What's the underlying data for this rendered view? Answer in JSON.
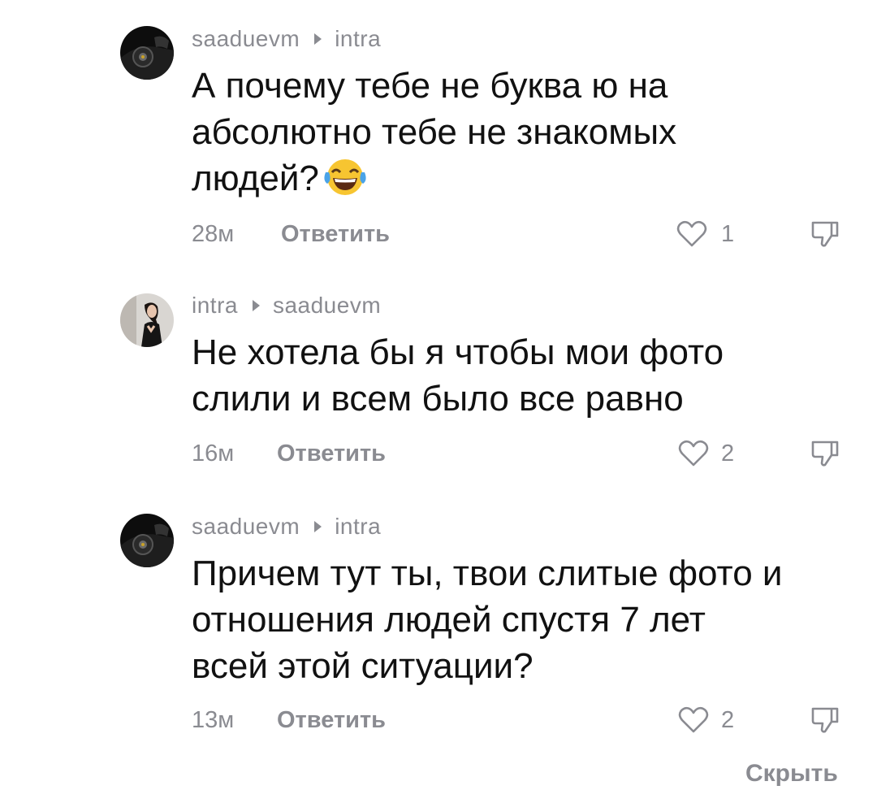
{
  "comments": [
    {
      "author": "saaduevm",
      "reply_to": "intra",
      "lines": [
        "А почему тебе не буква ю на",
        "абсолютно тебе не знакомых",
        "людей?"
      ],
      "emoji": "tears-of-joy-emoji",
      "time": "28м",
      "reply_label": "Ответить",
      "likes": "1",
      "avatar": "car-avatar-icon"
    },
    {
      "author": "intra",
      "reply_to": "saaduevm",
      "lines": [
        "Не хотела бы я чтобы мои фото",
        "слили и всем было все равно"
      ],
      "time": "16м",
      "reply_label": "Ответить",
      "likes": "2",
      "avatar": "person-avatar-icon"
    },
    {
      "author": "saaduevm",
      "reply_to": "intra",
      "lines": [
        "Причем тут ты, твои слитые фото и",
        "отношения людей спустя 7 лет",
        "всей этой ситуации?"
      ],
      "time": "13м",
      "reply_label": "Ответить",
      "likes": "2",
      "avatar": "car-avatar-icon"
    }
  ],
  "footer": {
    "hide_label": "Скрыть"
  },
  "colors": {
    "text": "#111111",
    "muted": "#8a8b91",
    "background": "#ffffff"
  }
}
